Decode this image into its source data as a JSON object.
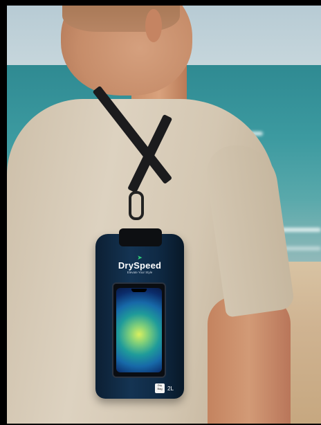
{
  "product": {
    "brand": "DrySpeed",
    "tagline": "Elevate Your Style",
    "badge": "Dry Bag",
    "capacity": "2L",
    "icon": "drop-logo-icon"
  }
}
